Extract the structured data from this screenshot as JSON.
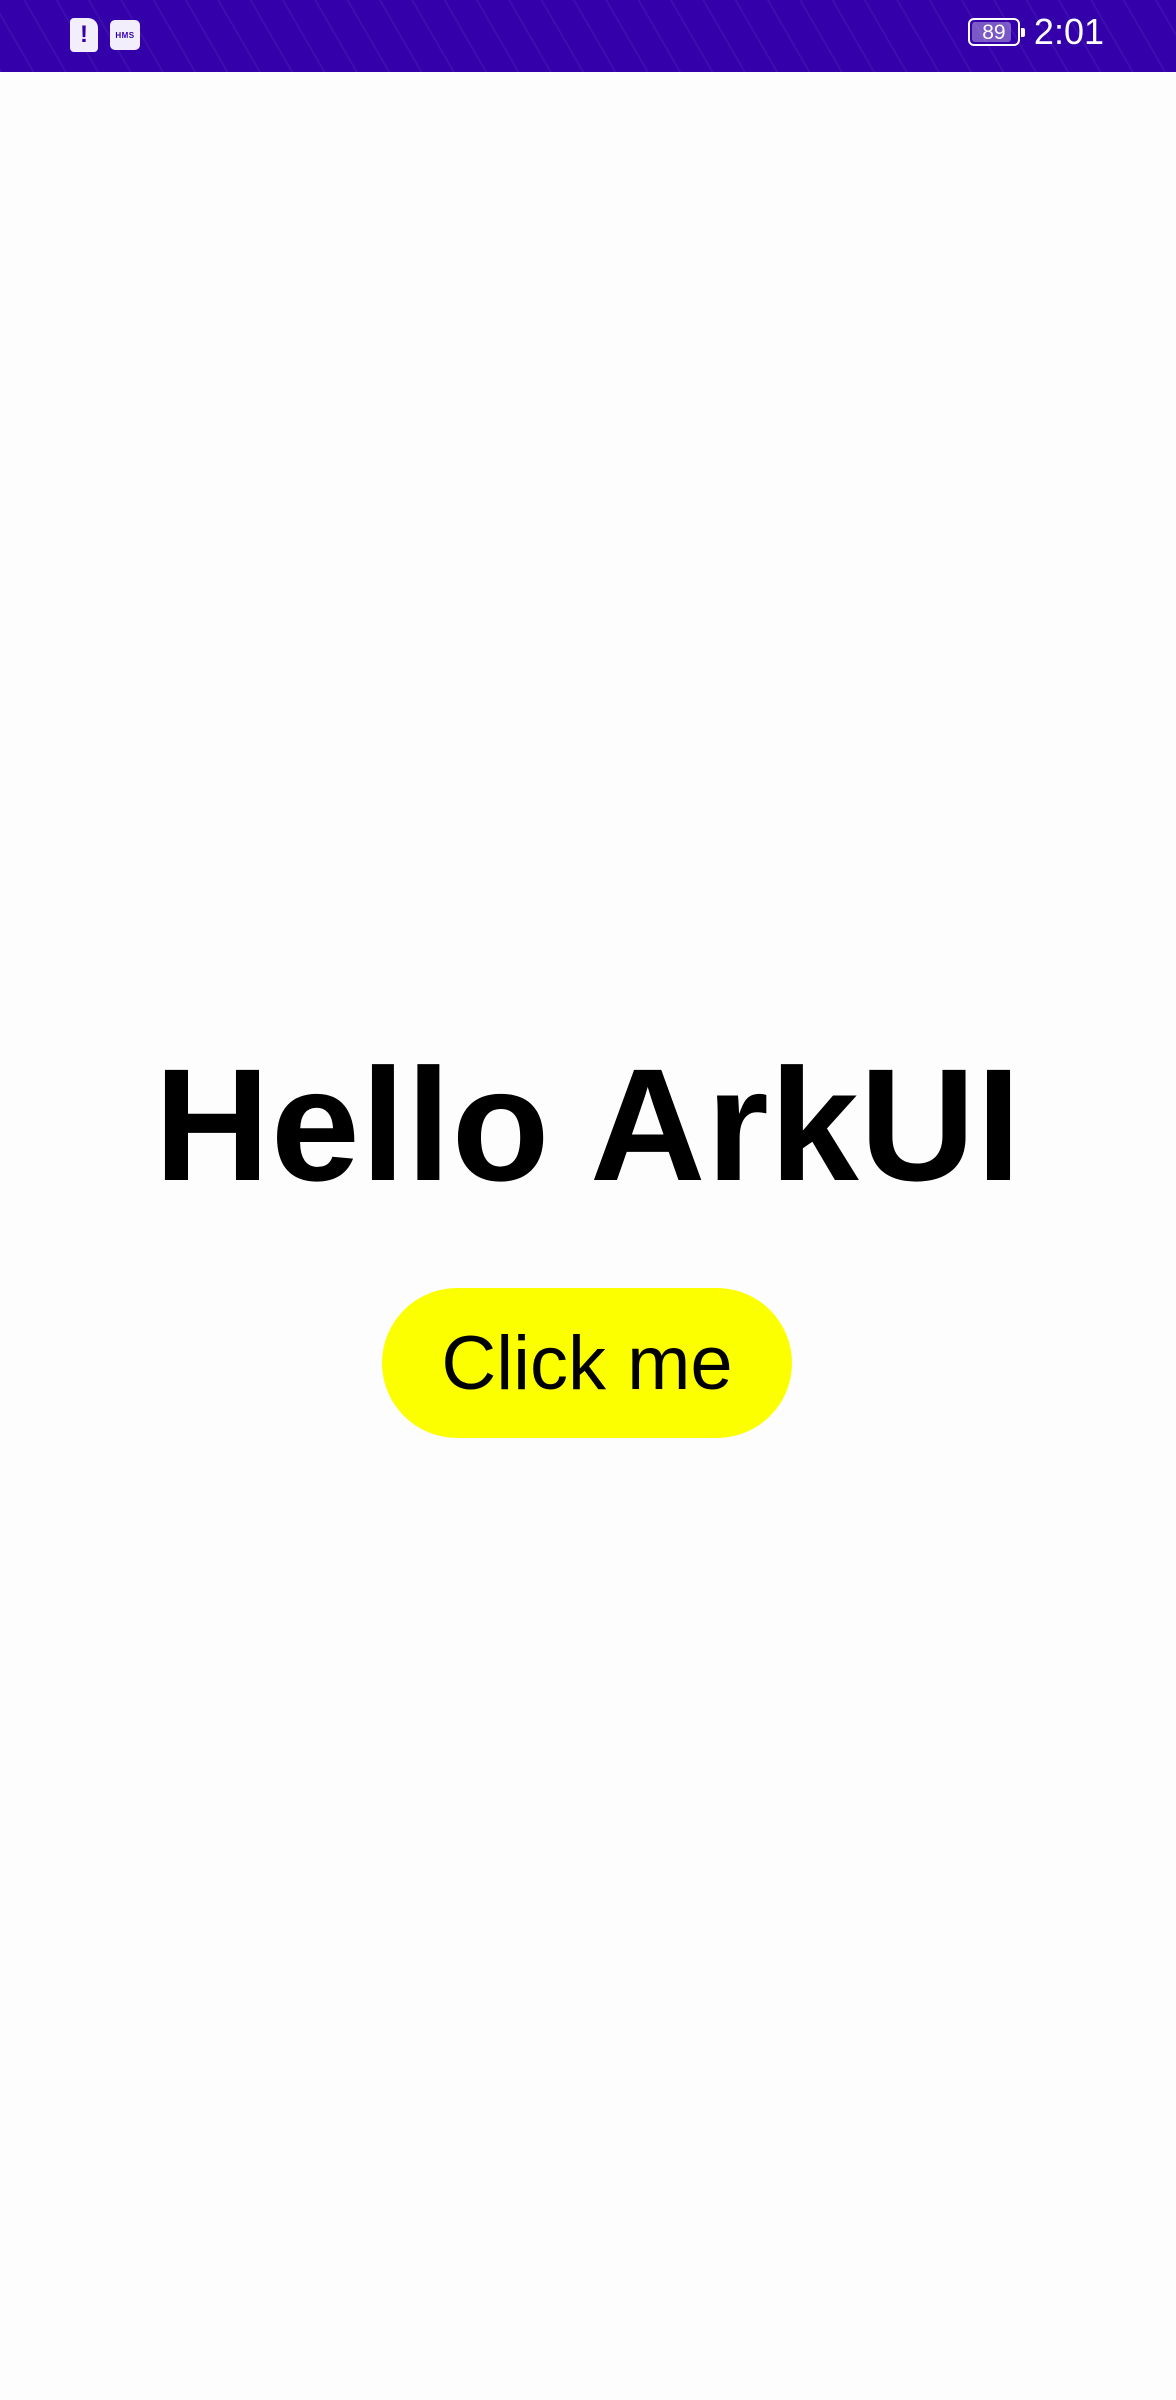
{
  "status_bar": {
    "left_icons": [
      "sim-alert-icon",
      "hms-icon"
    ],
    "hms_label": "HMS",
    "battery_level": "89",
    "battery_fraction": 0.89,
    "time": "2:01",
    "background_color": "#3300aa"
  },
  "main": {
    "headline": "Hello ArkUI",
    "button_label": "Click me",
    "button_color": "#fbff00"
  }
}
